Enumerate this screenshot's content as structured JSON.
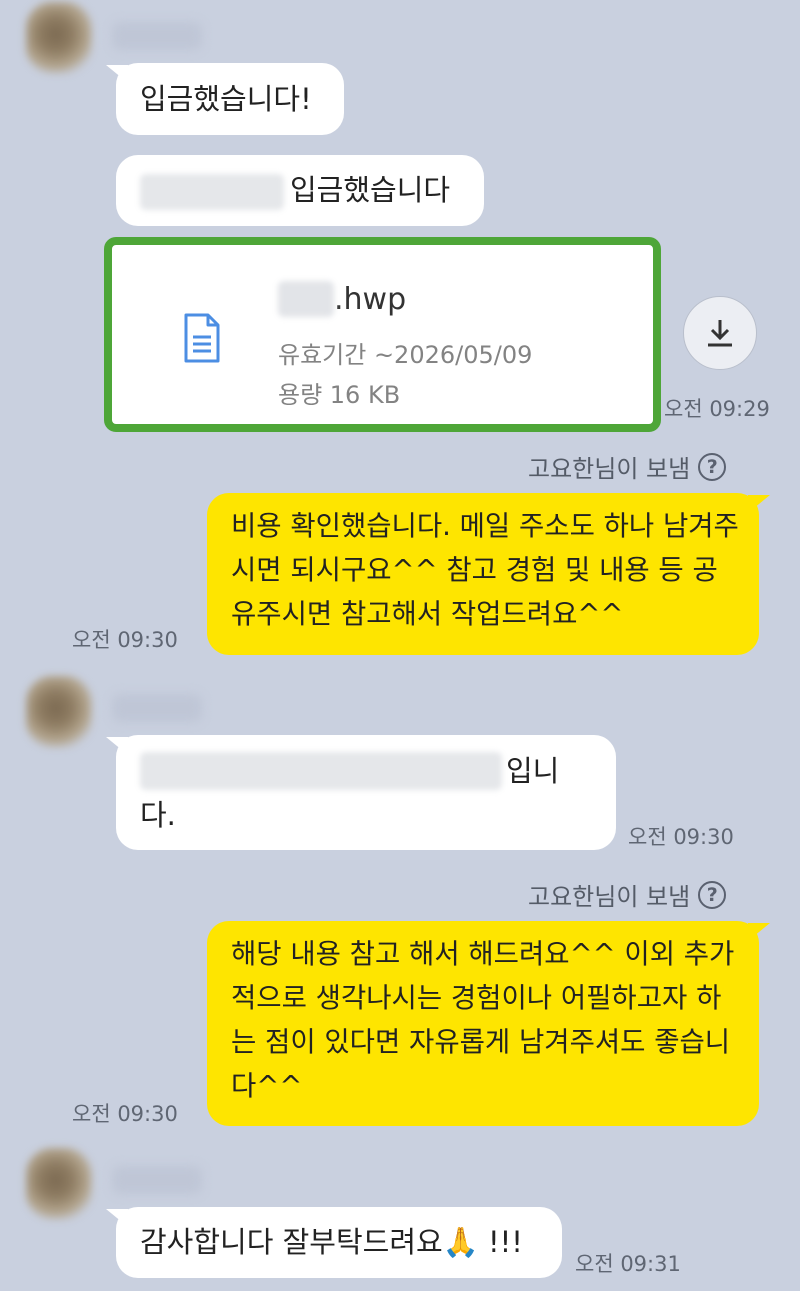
{
  "messages": {
    "m1_text": "입금했습니다!",
    "m2_text": "입금했습니다",
    "file": {
      "ext": ".hwp",
      "expiry": "유효기간 ~2026/05/09",
      "size": "용량 16 KB",
      "time": "오전 09:29",
      "download_icon": "download-icon",
      "file_icon": "document-icon"
    },
    "sent_by_label": "고요한님이 보냄",
    "help_icon": "?",
    "m3_text": "비용 확인했습니다. 메일 주소도 하나 남겨주시면 되시구요^^ 참고 경험 및 내용 등 공유주시면 참고해서 작업드려요^^",
    "m3_time": "오전 09:30",
    "m4_suffix": "입니",
    "m4_line2": "다.",
    "m4_time": "오전 09:30",
    "m5_text": "해당 내용 참고 해서 해드려요^^ 이외 추가적으로 생각나시는 경험이나 어필하고자 하는 점이 있다면 자유롭게 남겨주셔도 좋습니다^^",
    "m5_time": "오전 09:30",
    "m6_text": "감사합니다 잘부탁드려요🙏 !!!",
    "m6_time": "오전 09:31"
  },
  "colors": {
    "background": "#c9d0df",
    "my_bubble": "#fee500",
    "highlight_border": "#4ea638"
  }
}
